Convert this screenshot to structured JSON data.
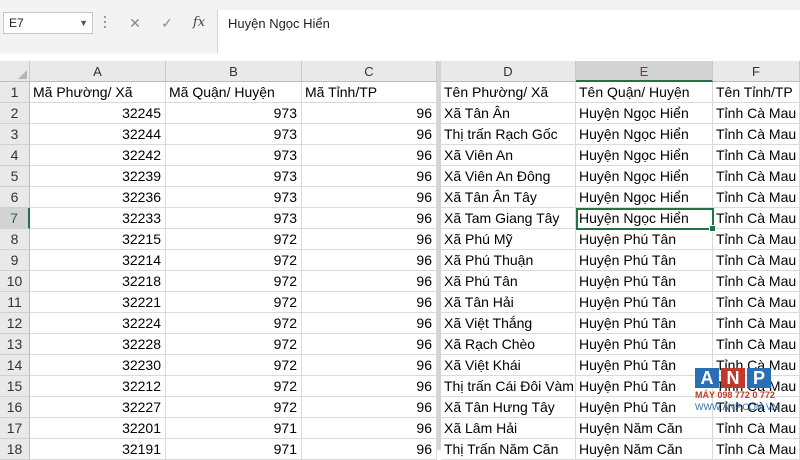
{
  "formula_bar": {
    "name_box": "E7",
    "cancel_glyph": "✕",
    "enter_glyph": "✓",
    "fx_glyph": "fx",
    "formula": "Huyện Ngọc Hiển"
  },
  "columns": [
    "A",
    "B",
    "C",
    "D",
    "E",
    "F"
  ],
  "rows": [
    "1",
    "2",
    "3",
    "4",
    "5",
    "6",
    "7",
    "8",
    "9",
    "10",
    "11",
    "12",
    "13",
    "14",
    "15",
    "16",
    "17",
    "18"
  ],
  "header_row": [
    "Mã Phường/ Xã",
    "Mã Quận/ Huyện",
    "Mã Tỉnh/TP",
    "Tên Phường/ Xã",
    "Tên Quận/ Huyện",
    "Tên Tỉnh/TP"
  ],
  "data_rows": [
    [
      "32245",
      "973",
      "96",
      "Xã Tân Ân",
      "Huyện Ngọc Hiển",
      "Tỉnh Cà Mau"
    ],
    [
      "32244",
      "973",
      "96",
      "Thị trấn Rạch Gốc",
      "Huyện Ngọc Hiển",
      "Tỉnh Cà Mau"
    ],
    [
      "32242",
      "973",
      "96",
      "Xã Viên An",
      "Huyện Ngọc Hiển",
      "Tỉnh Cà Mau"
    ],
    [
      "32239",
      "973",
      "96",
      "Xã Viên An Đông",
      "Huyện Ngọc Hiển",
      "Tỉnh Cà Mau"
    ],
    [
      "32236",
      "973",
      "96",
      "Xã Tân Ân Tây",
      "Huyện Ngọc Hiển",
      "Tỉnh Cà Mau"
    ],
    [
      "32233",
      "973",
      "96",
      "Xã Tam Giang Tây",
      "Huyện Ngọc Hiển",
      "Tỉnh Cà Mau"
    ],
    [
      "32215",
      "972",
      "96",
      "Xã Phú Mỹ",
      "Huyện Phú Tân",
      "Tỉnh Cà Mau"
    ],
    [
      "32214",
      "972",
      "96",
      "Xã Phú Thuận",
      "Huyện Phú Tân",
      "Tỉnh Cà Mau"
    ],
    [
      "32218",
      "972",
      "96",
      "Xã Phú Tân",
      "Huyện Phú Tân",
      "Tỉnh Cà Mau"
    ],
    [
      "32221",
      "972",
      "96",
      "Xã Tân Hải",
      "Huyện Phú Tân",
      "Tỉnh Cà Mau"
    ],
    [
      "32224",
      "972",
      "96",
      "Xã Việt Thắng",
      "Huyện Phú Tân",
      "Tỉnh Cà Mau"
    ],
    [
      "32228",
      "972",
      "96",
      "Xã Rạch Chèo",
      "Huyện Phú Tân",
      "Tỉnh Cà Mau"
    ],
    [
      "32230",
      "972",
      "96",
      "Xã Việt Khái",
      "Huyện Phú Tân",
      "Tỉnh Cà Mau"
    ],
    [
      "32212",
      "972",
      "96",
      "Thị trấn Cái Đôi Vàm",
      "Huyện Phú Tân",
      "Tỉnh Cà Mau"
    ],
    [
      "32227",
      "972",
      "96",
      "Xã Tân Hưng Tây",
      "Huyện Phú Tân",
      "Tỉnh Cà Mau"
    ],
    [
      "32201",
      "971",
      "96",
      "Xã Lâm Hải",
      "Huyện Năm Căn",
      "Tỉnh Cà Mau"
    ],
    [
      "32191",
      "971",
      "96",
      "Thị Trấn Năm Căn",
      "Huyện Năm Căn",
      "Tỉnh Cà Mau"
    ]
  ],
  "selection": {
    "column": "E",
    "row": "7"
  },
  "colors": {
    "accent": "#217346",
    "header_bg": "#e9e9e9",
    "gridline": "#dadada",
    "formula_bar_bg": "#f3f3f3"
  },
  "watermark": {
    "letters": [
      "A",
      "N",
      "P"
    ],
    "colors": [
      "#2a6fb5",
      "#c0392b",
      "#2a6fb5"
    ],
    "line1": "MÁY 098 772 0 772",
    "line2": "WWW.ANP.COM.VN"
  }
}
